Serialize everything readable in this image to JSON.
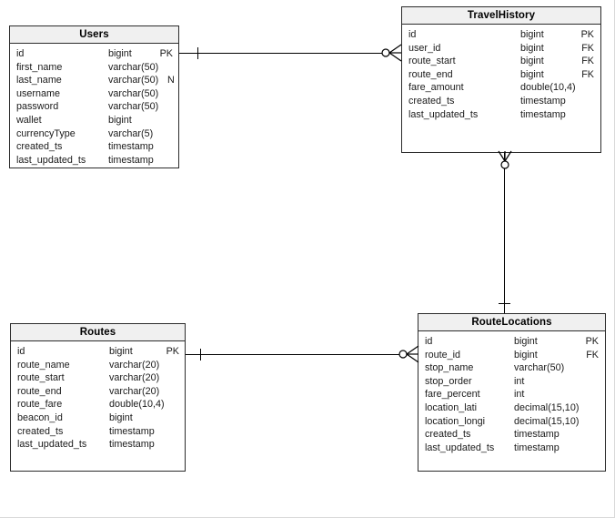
{
  "diagram": {
    "type": "entity-relationship-diagram",
    "notation": "crow's foot",
    "background_color": "#ffffff",
    "header_fill": "#f0f0f0",
    "border_color": "#2b2b2b"
  },
  "entities": [
    {
      "id": "users",
      "title": "Users",
      "fields": [
        {
          "name": "id",
          "type": "bigint",
          "key": "PK",
          "flag": ""
        },
        {
          "name": "first_name",
          "type": "varchar(50)",
          "key": "",
          "flag": ""
        },
        {
          "name": "last_name",
          "type": "varchar(50)",
          "key": "",
          "flag": "N"
        },
        {
          "name": "username",
          "type": "varchar(50)",
          "key": "",
          "flag": ""
        },
        {
          "name": "password",
          "type": "varchar(50)",
          "key": "",
          "flag": ""
        },
        {
          "name": "wallet",
          "type": "bigint",
          "key": "",
          "flag": ""
        },
        {
          "name": "currencyType",
          "type": "varchar(5)",
          "key": "",
          "flag": ""
        },
        {
          "name": "created_ts",
          "type": "timestamp",
          "key": "",
          "flag": ""
        },
        {
          "name": "last_updated_ts",
          "type": "timestamp",
          "key": "",
          "flag": ""
        }
      ]
    },
    {
      "id": "travelhistory",
      "title": "TravelHistory",
      "fields": [
        {
          "name": "id",
          "type": "bigint",
          "key": "PK",
          "flag": ""
        },
        {
          "name": "user_id",
          "type": "bigint",
          "key": "FK",
          "flag": ""
        },
        {
          "name": "route_start",
          "type": "bigint",
          "key": "FK",
          "flag": ""
        },
        {
          "name": "route_end",
          "type": "bigint",
          "key": "FK",
          "flag": ""
        },
        {
          "name": "fare_amount",
          "type": "double(10,4)",
          "key": "",
          "flag": ""
        },
        {
          "name": "created_ts",
          "type": "timestamp",
          "key": "",
          "flag": ""
        },
        {
          "name": "last_updated_ts",
          "type": "timestamp",
          "key": "",
          "flag": ""
        }
      ]
    },
    {
      "id": "routes",
      "title": "Routes",
      "fields": [
        {
          "name": "id",
          "type": "bigint",
          "key": "PK",
          "flag": ""
        },
        {
          "name": "route_name",
          "type": "varchar(20)",
          "key": "",
          "flag": ""
        },
        {
          "name": "route_start",
          "type": "varchar(20)",
          "key": "",
          "flag": ""
        },
        {
          "name": "route_end",
          "type": "varchar(20)",
          "key": "",
          "flag": ""
        },
        {
          "name": "route_fare",
          "type": "double(10,4)",
          "key": "",
          "flag": ""
        },
        {
          "name": "beacon_id",
          "type": "bigint",
          "key": "",
          "flag": ""
        },
        {
          "name": "created_ts",
          "type": "timestamp",
          "key": "",
          "flag": ""
        },
        {
          "name": "last_updated_ts",
          "type": "timestamp",
          "key": "",
          "flag": ""
        }
      ]
    },
    {
      "id": "routelocations",
      "title": "RouteLocations",
      "fields": [
        {
          "name": "id",
          "type": "bigint",
          "key": "PK",
          "flag": ""
        },
        {
          "name": "route_id",
          "type": "bigint",
          "key": "FK",
          "flag": ""
        },
        {
          "name": "stop_name",
          "type": "varchar(50)",
          "key": "",
          "flag": ""
        },
        {
          "name": "stop_order",
          "type": "int",
          "key": "",
          "flag": ""
        },
        {
          "name": "fare_percent",
          "type": "int",
          "key": "",
          "flag": ""
        },
        {
          "name": "location_lati",
          "type": "decimal(15,10)",
          "key": "",
          "flag": ""
        },
        {
          "name": "location_longi",
          "type": "decimal(15,10)",
          "key": "",
          "flag": ""
        },
        {
          "name": "created_ts",
          "type": "timestamp",
          "key": "",
          "flag": ""
        },
        {
          "name": "last_updated_ts",
          "type": "timestamp",
          "key": "",
          "flag": ""
        }
      ]
    }
  ],
  "relationships": [
    {
      "id": "users-travelhistory",
      "from": "Users",
      "to": "TravelHistory",
      "from_cardinality": "one",
      "to_cardinality": "zero-or-many"
    },
    {
      "id": "routelocations-travelhistory",
      "from": "RouteLocations",
      "to": "TravelHistory",
      "from_cardinality": "one",
      "to_cardinality": "zero-or-many"
    },
    {
      "id": "routes-routelocations",
      "from": "Routes",
      "to": "RouteLocations",
      "from_cardinality": "one",
      "to_cardinality": "zero-or-many"
    }
  ]
}
